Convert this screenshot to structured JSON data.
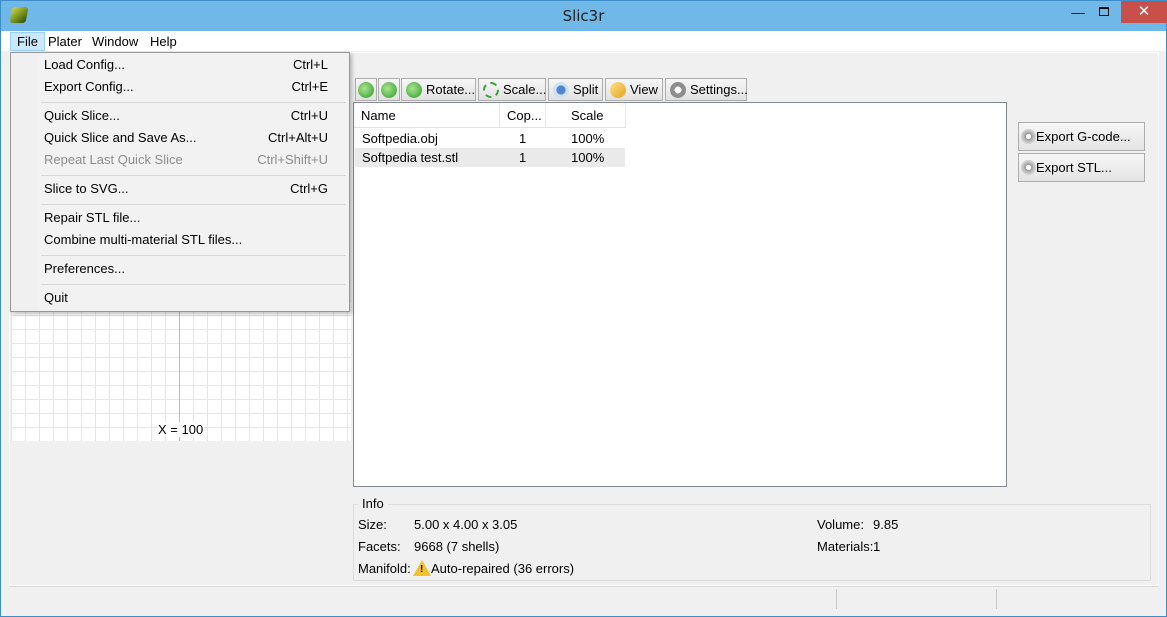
{
  "window": {
    "title": "Slic3r",
    "min_glyph": "—",
    "close_glyph": "✕"
  },
  "menubar": {
    "items": [
      "File",
      "Plater",
      "Window",
      "Help"
    ]
  },
  "file_menu": {
    "items": [
      {
        "label": "Load Config...",
        "shortcut": "Ctrl+L"
      },
      {
        "label": "Export Config...",
        "shortcut": "Ctrl+E"
      },
      {
        "label": "Quick Slice...",
        "shortcut": "Ctrl+U"
      },
      {
        "label": "Quick Slice and Save As...",
        "shortcut": "Ctrl+Alt+U"
      },
      {
        "label": "Repeat Last Quick Slice",
        "shortcut": "Ctrl+Shift+U",
        "disabled": true
      },
      {
        "label": "Slice to SVG...",
        "shortcut": "Ctrl+G"
      },
      {
        "label": "Repair STL file...",
        "shortcut": ""
      },
      {
        "label": "Combine multi-material STL files...",
        "shortcut": ""
      },
      {
        "label": "Preferences...",
        "shortcut": ""
      },
      {
        "label": "Quit",
        "shortcut": ""
      }
    ]
  },
  "toolbar": {
    "rotate": "Rotate...",
    "scale": "Scale...",
    "split": "Split",
    "view": "View",
    "settings": "Settings..."
  },
  "object_list": {
    "headers": [
      "Name",
      "Cop...",
      "Scale"
    ],
    "rows": [
      {
        "name": "Softpedia.obj",
        "copies": "1",
        "scale": "100%"
      },
      {
        "name": "Softpedia test.stl",
        "copies": "1",
        "scale": "100%"
      }
    ]
  },
  "actions": {
    "export_gcode": "Export G-code...",
    "export_stl": "Export STL..."
  },
  "plater": {
    "x_label": "X = 100"
  },
  "info": {
    "legend": "Info",
    "size_label": "Size:",
    "size_value": "5.00 x 4.00 x 3.05",
    "volume_label": "Volume:",
    "volume_value": "9.85",
    "facets_label": "Facets:",
    "facets_value": "9668 (7 shells)",
    "materials_label": "Materials:",
    "materials_value": "1",
    "manifold_label": "Manifold:",
    "manifold_value": "Auto-repaired (36 errors)"
  },
  "colors": {
    "titlebar": "#70b8e8",
    "close_button": "#c7504b",
    "menu_highlight": "#cce8ff",
    "warning": "#f2c12e"
  }
}
